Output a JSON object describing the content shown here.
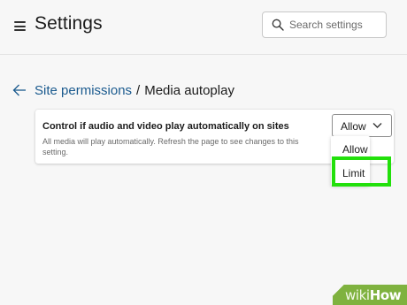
{
  "header": {
    "title": "Settings",
    "search": {
      "placeholder": "Search settings",
      "value": ""
    }
  },
  "breadcrumb": {
    "parent": "Site permissions",
    "separator": "/",
    "current": "Media autoplay"
  },
  "setting": {
    "title": "Control if audio and video play automatically on sites",
    "description": "All media will play automatically. Refresh the page to see changes to this setting.",
    "selected": "Allow",
    "options": [
      "Allow",
      "Limit"
    ]
  },
  "watermark": {
    "wiki": "wiki",
    "how": "How"
  },
  "colors": {
    "link": "#1a5a8e",
    "highlight": "#22e00b",
    "watermark_bg": "#7fb23f",
    "background": "#f7f7f7"
  },
  "icons": {
    "menu": "hamburger-menu-icon",
    "search": "search-icon",
    "back": "back-arrow-icon",
    "dropdown": "chevron-down-icon"
  }
}
